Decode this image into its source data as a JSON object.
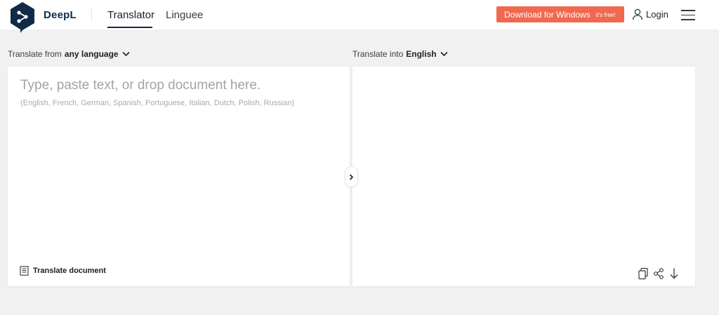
{
  "header": {
    "brand": "DeepL",
    "tabs": [
      {
        "label": "Translator",
        "active": true
      },
      {
        "label": "Linguee",
        "active": false
      }
    ],
    "download": {
      "label": "Download for Windows",
      "badge": "it's free!"
    },
    "login_label": "Login",
    "menu_icon": "hamburger-icon"
  },
  "source": {
    "lang_prefix": "Translate from",
    "lang_value": "any language",
    "placeholder": "Type, paste text, or drop document here.",
    "hint": "(English, French, German, Spanish, Portuguese, Italian, Dutch, Polish, Russian)",
    "translate_document_label": "Translate document"
  },
  "target": {
    "lang_prefix": "Translate into",
    "lang_value": "English",
    "tools": [
      "copy-icon",
      "share-icon",
      "download-icon"
    ]
  },
  "colors": {
    "brand_navy": "#0f2b46",
    "accent_orange": "#f0694f",
    "page_bg": "#f1f1f1",
    "panel_bg": "#ffffff"
  }
}
